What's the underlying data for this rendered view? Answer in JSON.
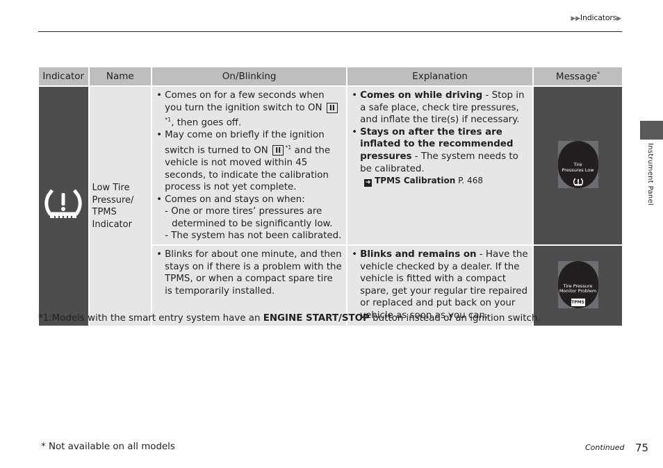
{
  "header": {
    "breadcrumb_prefix": "▶▶",
    "breadcrumb_label": "Indicators",
    "breadcrumb_suffix": "▶"
  },
  "side_tab": {
    "label": "Instrument Panel"
  },
  "table": {
    "headers": {
      "indicator": "Indicator",
      "name": "Name",
      "on_blinking": "On/Blinking",
      "explanation": "Explanation",
      "message": "Message",
      "message_mark": "*"
    },
    "row": {
      "indicator_icon": "tire-pressure-warning-icon",
      "name": "Low Tire Pressure/ TPMS Indicator",
      "on_blinking_1": {
        "b1_a": "Comes on for a few seconds when you turn the ignition switch to ON",
        "key": "II",
        "fn": "*1",
        "b1_b": ", then goes off.",
        "b2_a": "May come on briefly if the ignition switch is turned to ON",
        "b2_b": " and the vehicle is not moved within 45 seconds, to indicate the calibration process is not yet complete.",
        "b3": "Comes on and stays on when:",
        "sub1": "- One or more tires’ pressures are determined to be significantly low.",
        "sub2": "- The system has not been calibrated."
      },
      "explanation_1": {
        "b1_bold": "Comes on while driving",
        "b1_text": " - Stop in a safe place, check tire pressures, and inflate the tire(s) if necessary.",
        "b2_bold": "Stays on after the tires are inflated to the recommended pressures",
        "b2_text": " - The system needs to be calibrated.",
        "ref_label": "TPMS Calibration",
        "ref_page": " P. 468"
      },
      "message_1": {
        "line1": "Tire",
        "line2": "Pressures Low",
        "icon": "tire-pressure-warning-icon"
      },
      "on_blinking_2": "Blinks for about one minute, and then stays on if there is a problem with the TPMS, or when a compact spare tire is temporarily installed.",
      "explanation_2": {
        "b1_bold": "Blinks and remains on",
        "b1_text": " - Have the vehicle checked by a dealer. If the vehicle is fitted with a compact spare, get your regular tire repaired or replaced and put back on your vehicle as soon as you can."
      },
      "message_2": {
        "line1": "Tire Pressure",
        "line2": "Monitor Problem",
        "badge": "TPMS"
      }
    }
  },
  "footnote": {
    "prefix": "*1:Models with the smart entry system have an ",
    "bold": "ENGINE START/STOP",
    "suffix": " button instead of an ignition switch."
  },
  "footer": {
    "note": "* Not available on all models",
    "continued": "Continued",
    "page_number": "75"
  }
}
